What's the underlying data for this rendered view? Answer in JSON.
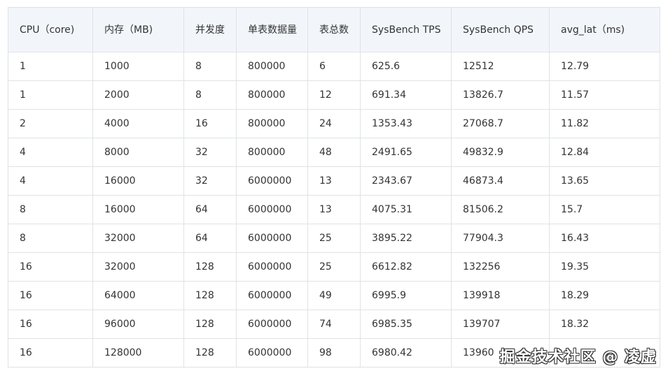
{
  "table": {
    "headers": [
      "CPU（core)",
      "内存（MB)",
      "并发度",
      "单表数据量",
      "表总数",
      "SysBench TPS",
      "SysBench QPS",
      "avg_lat（ms)"
    ],
    "rows": [
      [
        "1",
        "1000",
        "8",
        "800000",
        "6",
        "625.6",
        "12512",
        "12.79"
      ],
      [
        "1",
        "2000",
        "8",
        "800000",
        "12",
        "691.34",
        "13826.7",
        "11.57"
      ],
      [
        "2",
        "4000",
        "16",
        "800000",
        "24",
        "1353.43",
        "27068.7",
        "11.82"
      ],
      [
        "4",
        "8000",
        "32",
        "800000",
        "48",
        "2491.65",
        "49832.9",
        "12.84"
      ],
      [
        "4",
        "16000",
        "32",
        "6000000",
        "13",
        "2343.67",
        "46873.4",
        "13.65"
      ],
      [
        "8",
        "16000",
        "64",
        "6000000",
        "13",
        "4075.31",
        "81506.2",
        "15.7"
      ],
      [
        "8",
        "32000",
        "64",
        "6000000",
        "25",
        "3895.22",
        "77904.3",
        "16.43"
      ],
      [
        "16",
        "32000",
        "128",
        "6000000",
        "25",
        "6612.82",
        "132256",
        "19.35"
      ],
      [
        "16",
        "64000",
        "128",
        "6000000",
        "49",
        "6995.9",
        "139918",
        "18.29"
      ],
      [
        "16",
        "96000",
        "128",
        "6000000",
        "74",
        "6985.35",
        "139707",
        "18.32"
      ],
      [
        "16",
        "128000",
        "128",
        "6000000",
        "98",
        "6980.42",
        "13960",
        ""
      ]
    ]
  },
  "watermark": "掘金技术社区 @ 凌虚",
  "colors": {
    "header_bg": "#f2f6fa",
    "border": "#dfe2e5",
    "text": "#333333"
  }
}
